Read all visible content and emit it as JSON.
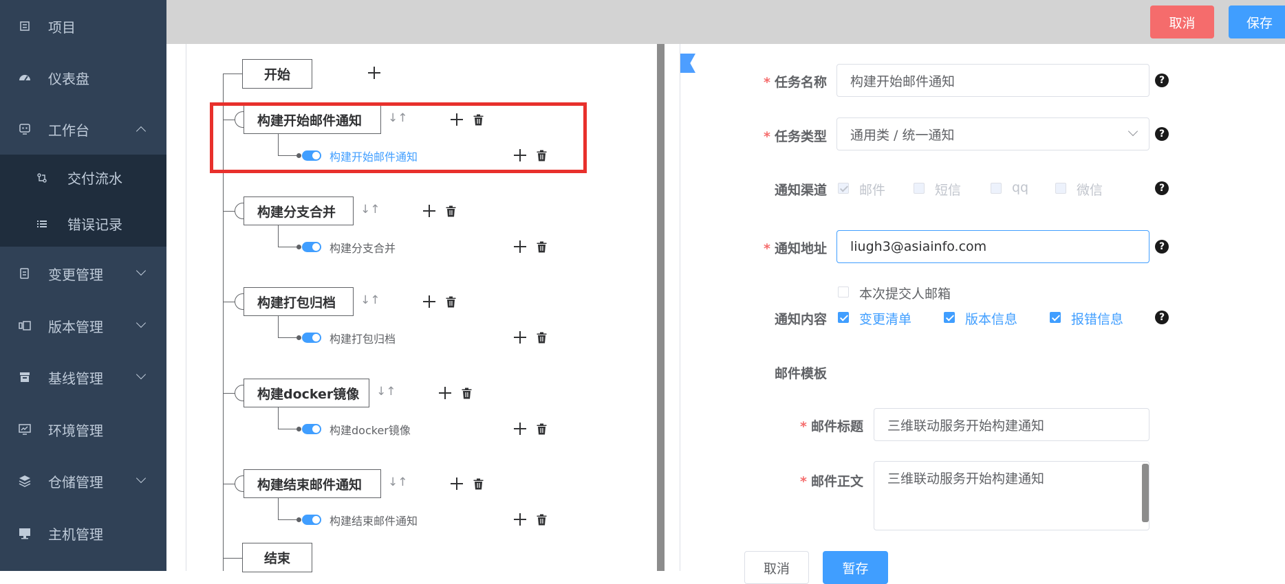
{
  "sidebar": {
    "items": [
      {
        "label": "项目",
        "icon": "project-icon"
      },
      {
        "label": "仪表盘",
        "icon": "dashboard-icon"
      },
      {
        "label": "工作台",
        "icon": "workbench-icon"
      },
      {
        "label": "变更管理",
        "icon": "change-icon"
      },
      {
        "label": "版本管理",
        "icon": "version-icon"
      },
      {
        "label": "基线管理",
        "icon": "baseline-icon"
      },
      {
        "label": "环境管理",
        "icon": "environment-icon"
      },
      {
        "label": "仓储管理",
        "icon": "storage-icon"
      },
      {
        "label": "主机管理",
        "icon": "host-icon"
      }
    ],
    "sub_items": [
      {
        "label": "交付流水",
        "icon": "pipeline-icon"
      },
      {
        "label": "错误记录",
        "icon": "list-icon"
      }
    ]
  },
  "topbar": {
    "cancel": "取消",
    "save": "保存"
  },
  "flow": {
    "start": "开始",
    "end": "结束",
    "nodes": [
      {
        "title": "构建开始邮件通知",
        "sub": "构建开始邮件通知"
      },
      {
        "title": "构建分支合并",
        "sub": "构建分支合并"
      },
      {
        "title": "构建打包归档",
        "sub": "构建打包归档"
      },
      {
        "title": "构建docker镜像",
        "sub": "构建docker镜像"
      },
      {
        "title": "构建结束邮件通知",
        "sub": "构建结束邮件通知"
      }
    ]
  },
  "form": {
    "task_name_label": "任务名称",
    "task_name_value": "构建开始邮件通知",
    "task_type_label": "任务类型",
    "task_type_value": "通用类 / 统一通知",
    "channel_label": "通知渠道",
    "channels": [
      "邮件",
      "短信",
      "qq",
      "微信"
    ],
    "address_label": "通知地址",
    "address_value": "liugh3@asiainfo.com",
    "submitter_label": "本次提交人邮箱",
    "content_label": "通知内容",
    "contents": [
      "变更清单",
      "版本信息",
      "报错信息"
    ],
    "template_label": "邮件模板",
    "mail_title_label": "邮件标题",
    "mail_title_value": "三维联动服务开始构建通知",
    "mail_body_label": "邮件正文",
    "mail_body_value": "三维联动服务开始构建通知",
    "help": "?",
    "cancel": "取消",
    "save": "暂存"
  },
  "colors": {
    "sidebar_bg": "#304156",
    "primary": "#409eff",
    "danger": "#f56c6c",
    "highlight": "#e8302c"
  }
}
